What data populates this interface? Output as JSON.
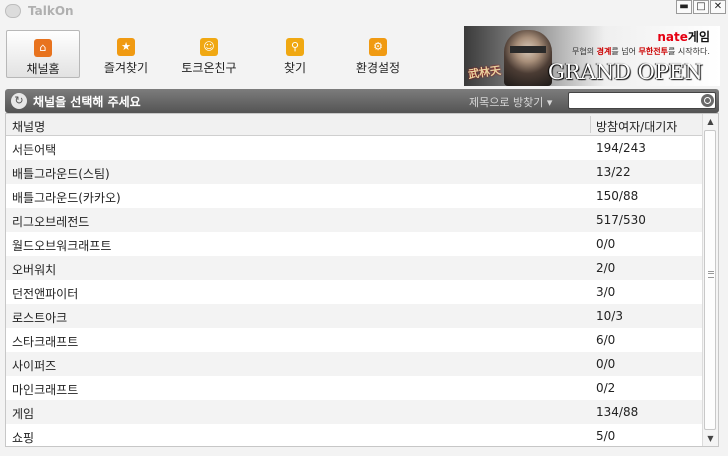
{
  "window": {
    "title": "TalkOn",
    "minimize_glyph": "▬",
    "maximize_glyph": "□",
    "close_glyph": "✕"
  },
  "toolbar": {
    "items": [
      {
        "label": "채널홈",
        "icon": "channel-home-icon",
        "color": "#e8731e",
        "active": true
      },
      {
        "label": "즐겨찾기",
        "icon": "star-icon",
        "color": "#f09a12",
        "active": false
      },
      {
        "label": "토크온친구",
        "icon": "smiley-icon",
        "color": "#f0a812",
        "active": false
      },
      {
        "label": "찾기",
        "icon": "magnifier-icon",
        "color": "#f0a812",
        "active": false
      },
      {
        "label": "환경설정",
        "icon": "gear-icon",
        "color": "#f09a12",
        "active": false
      }
    ]
  },
  "ad": {
    "brand_logo": "nate",
    "brand_suffix": "게임",
    "tagline_pre": "무협의 ",
    "tagline_em1": "경계",
    "tagline_mid": "를 넘어 ",
    "tagline_em2": "무한전투",
    "tagline_post": "를 시작하다.",
    "headline": "GRAND OPEN",
    "logo_text": "武林天"
  },
  "channel_bar": {
    "title": "채널을 선택해 주세요",
    "search_mode": "제목으로 방찾기 ▾",
    "search_value": ""
  },
  "table": {
    "columns": [
      "채널명",
      "방참여자/대기자"
    ],
    "rows": [
      {
        "name": "서든어택",
        "count": "194/243"
      },
      {
        "name": "배틀그라운드(스팀)",
        "count": "13/22"
      },
      {
        "name": "배틀그라운드(카카오)",
        "count": "150/88"
      },
      {
        "name": "리그오브레전드",
        "count": "517/530"
      },
      {
        "name": "월드오브워크래프트",
        "count": "0/0"
      },
      {
        "name": "오버워치",
        "count": "2/0"
      },
      {
        "name": "던전앤파이터",
        "count": "3/0"
      },
      {
        "name": "로스트아크",
        "count": "10/3"
      },
      {
        "name": "스타크래프트",
        "count": "6/0"
      },
      {
        "name": "사이퍼즈",
        "count": "0/0"
      },
      {
        "name": "마인크래프트",
        "count": "0/2"
      },
      {
        "name": "게임",
        "count": "134/88"
      },
      {
        "name": "쇼핑",
        "count": "5/0"
      }
    ]
  },
  "colors": {
    "accent_orange": "#f09a12",
    "header_bar": "#5f5f5f",
    "nate_red": "#e60012"
  }
}
